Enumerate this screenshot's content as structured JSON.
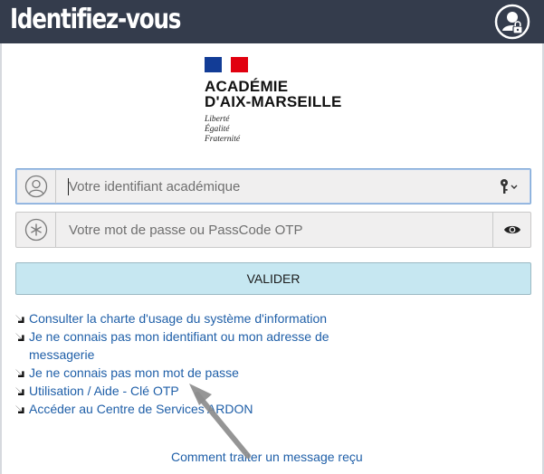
{
  "header": {
    "title": "Identifiez-vous",
    "icon": "lock-user-icon"
  },
  "logo": {
    "name_line1": "ACADÉMIE",
    "name_line2": "D'AIX-MARSEILLE",
    "motto_1": "Liberté",
    "motto_2": "Égalité",
    "motto_3": "Fraternité",
    "flag_colors": [
      "#123c96",
      "#ffffff",
      "#e1000f"
    ]
  },
  "form": {
    "username_placeholder": "Votre identifiant académique",
    "username_value": "",
    "password_placeholder": "Votre mot de passe ou PassCode OTP",
    "password_value": "",
    "submit_label": "VALIDER"
  },
  "links": [
    "Consulter la charte d'usage du système d'information",
    "Je ne connais pas mon identifiant ou mon adresse de messagerie",
    "Je ne connais pas mon mot de passe",
    "Utilisation / Aide - Clé OTP",
    "Accéder au Centre de Services ARDON"
  ],
  "bottom_link": "Comment traiter un message reçu",
  "colors": {
    "header_bg": "#343c4c",
    "link": "#1f5fa8",
    "button_bg": "#c6e7f1"
  }
}
